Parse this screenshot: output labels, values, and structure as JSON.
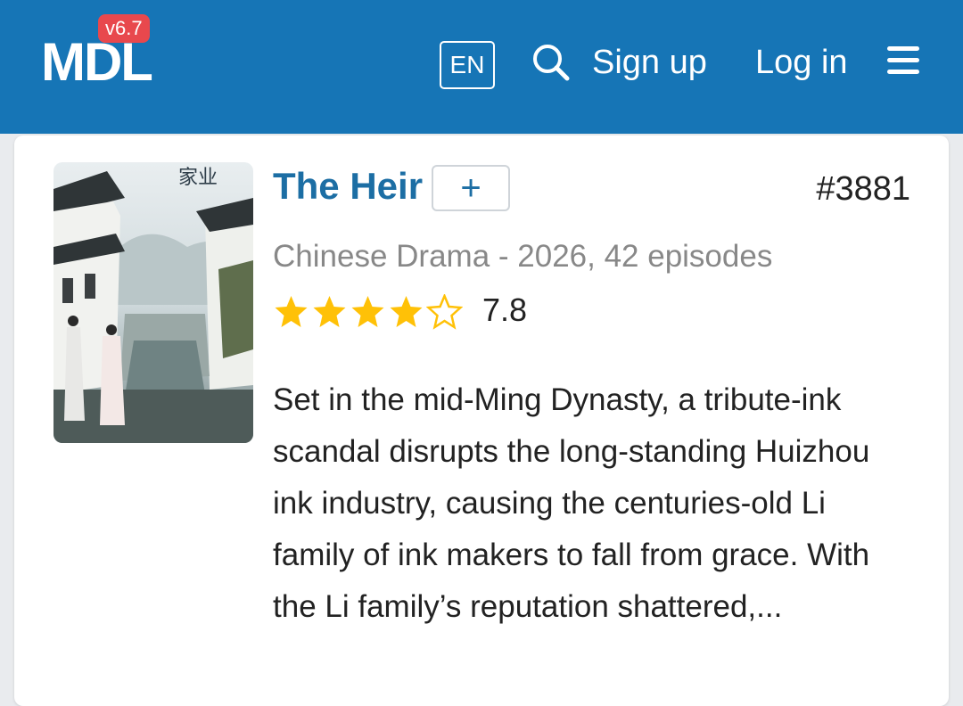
{
  "header": {
    "logo": "MDL",
    "version": "v6.7",
    "language": "EN",
    "signup": "Sign up",
    "login": "Log in",
    "icons": [
      "search-icon",
      "hamburger-menu-icon"
    ]
  },
  "drama": {
    "title": "The Heir",
    "add_label": "+",
    "rank": "#3881",
    "meta": "Chinese Drama - 2026, 42 episodes",
    "rating_stars": 4,
    "rating_max": 5,
    "score": "7.8",
    "synopsis": "Set in the mid-Ming Dynasty, a tribute-ink scandal disrupts the long-standing Huizhou ink industry, causing the centuries-old Li family of ink makers to fall from grace. With the Li family’s reputation shattered,...",
    "poster_title": "家业"
  },
  "colors": {
    "header_bg": "#1675b6",
    "badge": "#e8484d",
    "title": "#1c6ea4",
    "star": "#ffc107"
  }
}
